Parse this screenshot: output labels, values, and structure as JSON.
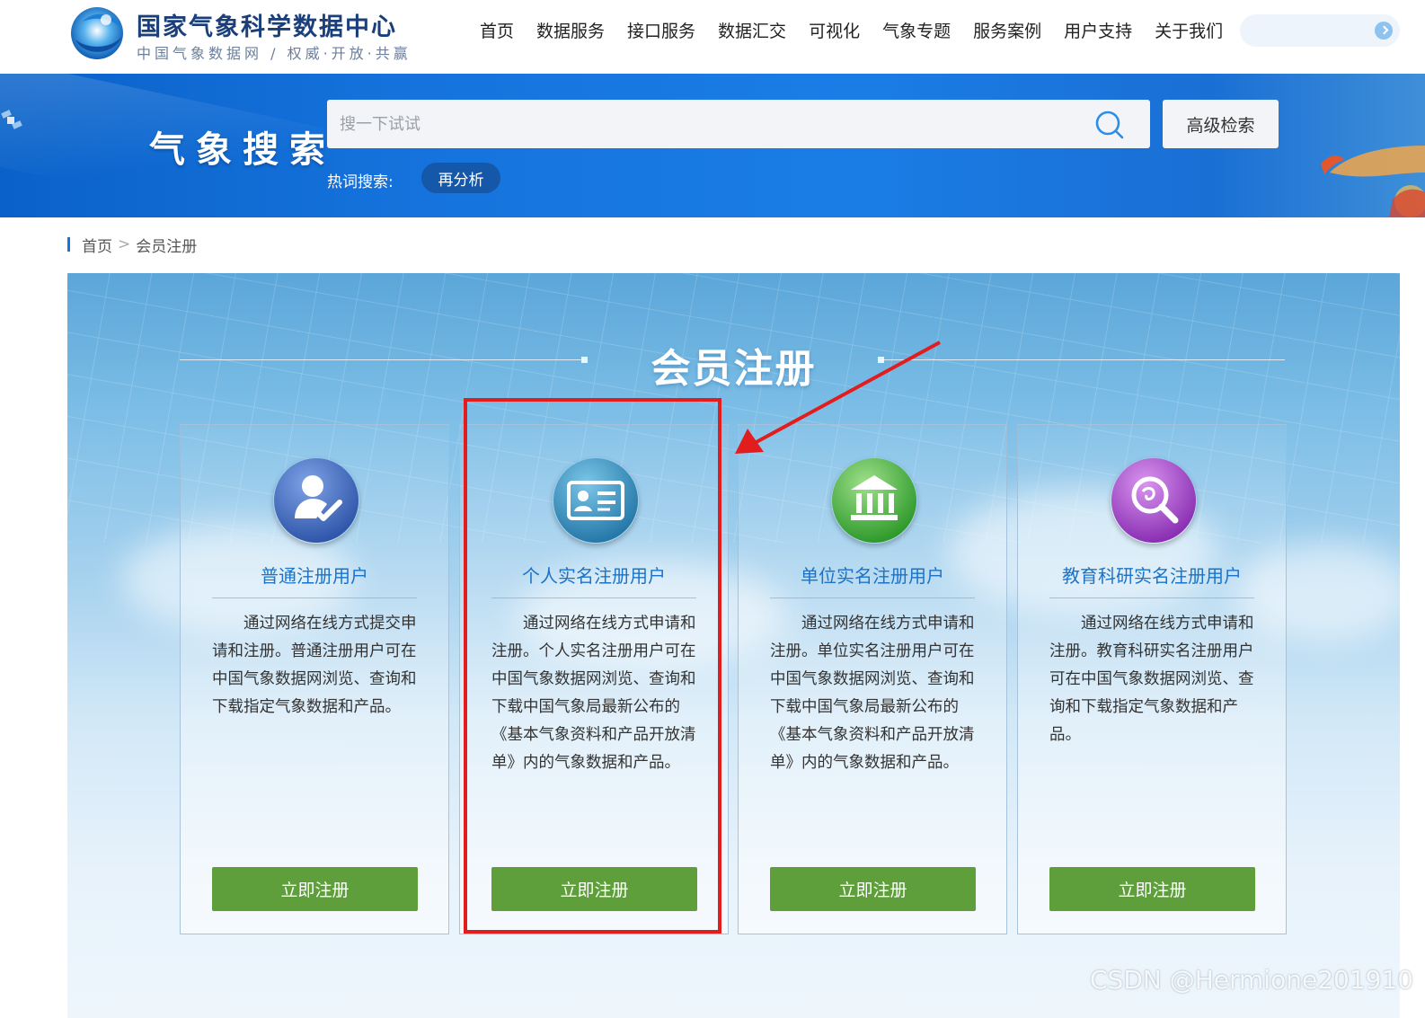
{
  "brand": {
    "title": "国家气象科学数据中心",
    "subtitle": "中国气象数据网 / 权威·开放·共赢"
  },
  "nav": {
    "items": [
      "首页",
      "数据服务",
      "接口服务",
      "数据汇交",
      "可视化",
      "气象专题",
      "服务案例",
      "用户支持",
      "关于我们"
    ]
  },
  "banner": {
    "title": "气象搜索",
    "search_placeholder": "搜一下试试",
    "advanced_search_label": "高级检索",
    "hot_label": "热词搜索:",
    "hot_tags": [
      "再分析"
    ]
  },
  "breadcrumb": {
    "home": "首页",
    "separator": ">",
    "current": "会员注册"
  },
  "registration": {
    "title": "会员注册",
    "cards": [
      {
        "name": "普通注册用户",
        "icon": "user-check-icon",
        "icon_color": "#3a63b8",
        "description": "通过网络在线方式提交申请和注册。普通注册用户可在中国气象数据网浏览、查询和下载指定气象数据和产品。",
        "button_label": "立即注册"
      },
      {
        "name": "个人实名注册用户",
        "icon": "id-card-icon",
        "icon_color": "#2f86b8",
        "description": "通过网络在线方式申请和注册。个人实名注册用户可在中国气象数据网浏览、查询和下载中国气象局最新公布的《基本气象资料和产品开放清单》内的气象数据和产品。",
        "button_label": "立即注册"
      },
      {
        "name": "单位实名注册用户",
        "icon": "institution-icon",
        "icon_color": "#4aa83a",
        "description": "通过网络在线方式申请和注册。单位实名注册用户可在中国气象数据网浏览、查询和下载中国气象局最新公布的《基本气象资料和产品开放清单》内的气象数据和产品。",
        "button_label": "立即注册"
      },
      {
        "name": "教育科研实名注册用户",
        "icon": "research-search-icon",
        "icon_color": "#9a3fc0",
        "description": "通过网络在线方式申请和注册。教育科研实名注册用户可在中国气象数据网浏览、查询和下载指定气象数据和产品。",
        "button_label": "立即注册"
      }
    ]
  },
  "colors": {
    "accent_blue": "#1a73d6",
    "button_green": "#5f9f3b",
    "annotation_red": "#e21d1d"
  },
  "watermark": "CSDN @Hermione201910"
}
